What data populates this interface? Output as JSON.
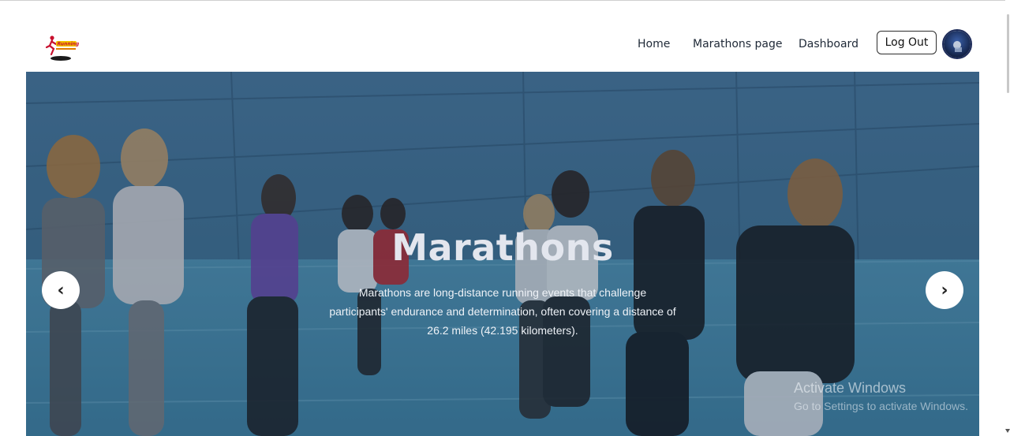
{
  "nav": {
    "links": [
      "Home",
      "Marathons page",
      "Dashboard"
    ],
    "logout_label": "Log Out"
  },
  "logo": {
    "text": "Running"
  },
  "hero": {
    "title": "Marathons",
    "description": "Marathons are long-distance running events that challenge participants' endurance and determination, often covering a distance of 26.2 miles (42.195 kilometers).",
    "prev_label": "‹",
    "next_label": "›"
  },
  "watermark": {
    "title": "Activate Windows",
    "subtitle": "Go to Settings to activate Windows."
  },
  "colors": {
    "hero_overlay": "#3a6d93",
    "text_dark": "#1f2937"
  }
}
